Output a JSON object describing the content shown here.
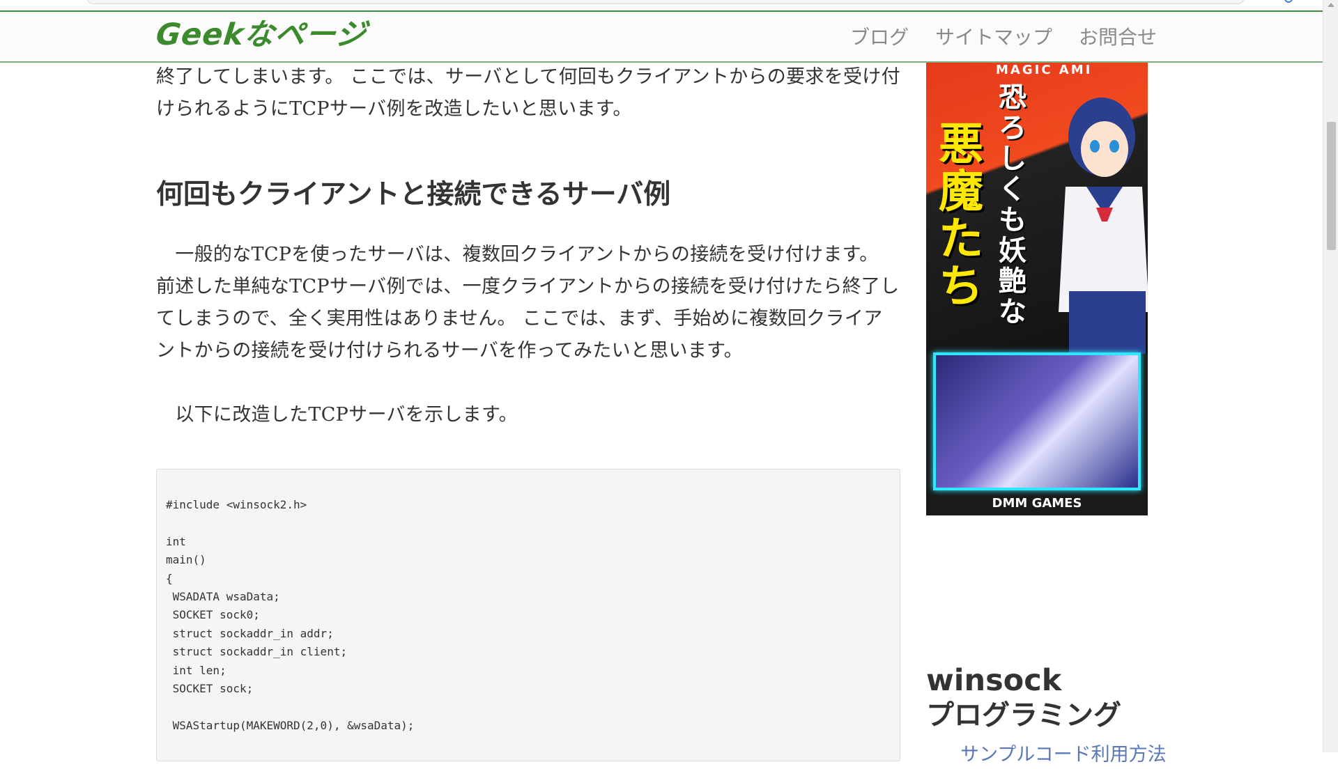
{
  "header": {
    "logo": "Geekなページ",
    "nav": [
      "ブログ",
      "サイトマップ",
      "お問合せ"
    ]
  },
  "article": {
    "intro": "終了してしまいます。 ここでは、サーバとして何回もクライアントからの要求を受け付けられるようにTCPサーバ例を改造したいと思います。",
    "heading": "何回もクライアントと接続できるサーバ例",
    "para2": "一般的なTCPを使ったサーバは、複数回クライアントからの接続を受け付けます。 前述した単純なTCPサーバ例では、一度クライアントからの接続を受け付けたら終了してしまうので、全く実用性はありません。 ここでは、まず、手始めに複数回クライアントからの接続を受け付けられるサーバを作ってみたいと思います。",
    "para3": "以下に改造したTCPサーバを示します。",
    "code_lines": [
      "#include <winsock2.h>",
      "",
      "int",
      "main()",
      "{",
      " WSADATA wsaData;",
      " SOCKET sock0;",
      " struct sockaddr_in addr;",
      " struct sockaddr_in client;",
      " int len;",
      " SOCKET sock;",
      "",
      " WSAStartup(MAKEWORD(2,0), &wsaData);"
    ]
  },
  "sidebar": {
    "ad": {
      "top_text": "MAGIC AMI",
      "title": "悪魔たち",
      "subtitle": "恐ろしくも妖艶な",
      "footer": "DMM GAMES"
    },
    "widget_title_en": "winsock",
    "widget_title_ja": "プログラミング",
    "widget_link": "サンプルコード利用方法"
  },
  "colors": {
    "brand_green": "#3b8a2e",
    "nav_gray": "#8a8a8a",
    "code_bg": "#f5f5f5",
    "link_blue": "#5a78b8"
  }
}
